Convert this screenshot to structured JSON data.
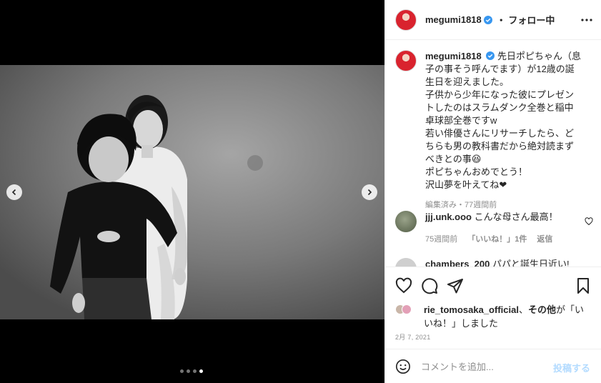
{
  "post": {
    "username": "megumi1818",
    "follow_label": "・ フォロー中"
  },
  "caption": {
    "username": "megumi1818",
    "lines": [
      "先日ポピちゃん（息",
      "子の事そう呼んでます）が12歳の誕",
      "生日を迎えました。",
      "子供から少年になった彼にプレゼン",
      "トしたのはスラムダンク全巻と稲中",
      "卓球部全巻ですw",
      "若い俳優さんにリサーチしたら、ど",
      "ちらも男の教科書だから絶対読まず",
      "べきとの事😆",
      "ポピちゃんおめでとう！",
      "沢山夢を叶えてね❤"
    ],
    "meta": "編集済み・77週間前"
  },
  "comments": [
    {
      "username": "jjj.unk.ooo",
      "text": "こんな母さん最高！",
      "time": "75週間前",
      "likes": "「いいね！」1件",
      "reply": "返信"
    },
    {
      "username": "chambers_200",
      "text": "パパと誕生日近い!"
    }
  ],
  "likes": {
    "user": "rie_tomosaka_official",
    "text_a": "、",
    "others": "その他",
    "text_b": "が「いいね！」しました"
  },
  "date": "2月 7, 2021",
  "compose": {
    "placeholder": "コメントを追加...",
    "post_label": "投稿する"
  },
  "icons": [
    "verified-icon",
    "more-icon",
    "heart-icon",
    "comment-icon",
    "share-icon",
    "bookmark-icon",
    "emoji-icon",
    "chevron-left-icon",
    "chevron-right-icon"
  ],
  "colors": {
    "verified": "#3897f0",
    "post_label": "#b3dbff",
    "meta": "#8e8e8e"
  },
  "carousel": {
    "total": 4,
    "active": 4
  }
}
